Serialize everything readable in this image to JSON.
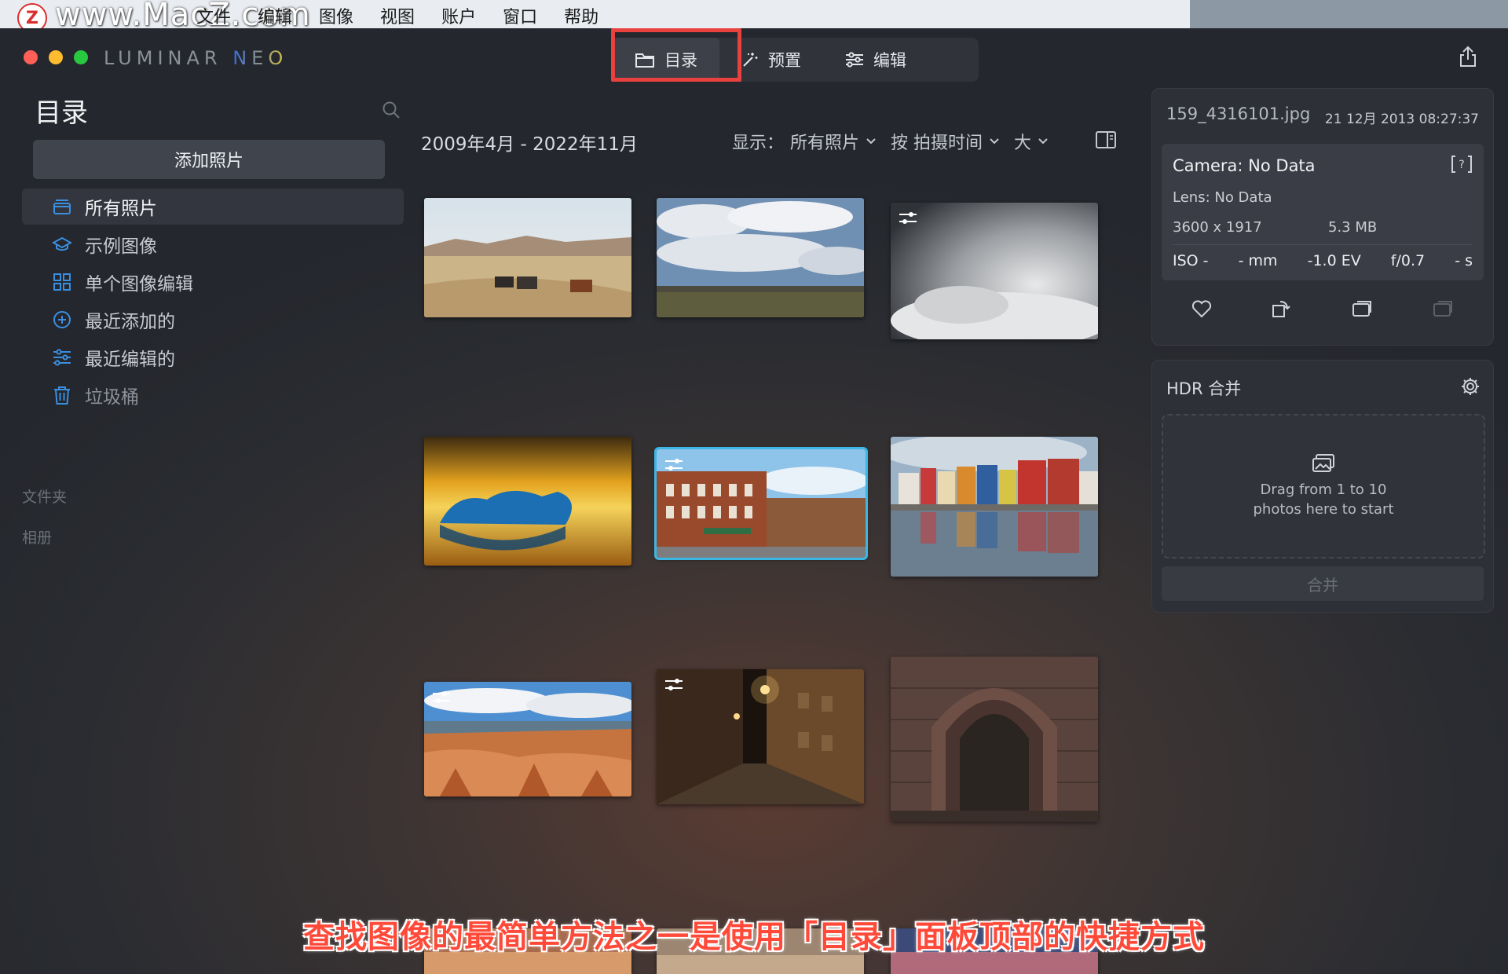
{
  "menubar": {
    "watermark": "www.MacZ.com",
    "app_name": "Luminar Neo",
    "menus": [
      "文件",
      "编辑",
      "图像",
      "视图",
      "账户",
      "窗口",
      "帮助"
    ]
  },
  "window": {
    "logo_left": "LUMINAR ",
    "logo_right": "NEO"
  },
  "tabs": [
    {
      "label": "目录",
      "icon": "folder-icon",
      "active": true
    },
    {
      "label": "预置",
      "icon": "sparkle-icon",
      "active": false
    },
    {
      "label": "编辑",
      "icon": "sliders-icon",
      "active": false
    }
  ],
  "sidebar": {
    "title": "目录",
    "add_button": "添加照片",
    "items": [
      {
        "label": "所有照片",
        "icon": "stack-icon"
      },
      {
        "label": "示例图像",
        "icon": "graduation-cap-icon"
      },
      {
        "label": "单个图像编辑",
        "icon": "grid-icon"
      },
      {
        "label": "最近添加的",
        "icon": "plus-circle-icon"
      },
      {
        "label": "最近编辑的",
        "icon": "sliders-icon"
      },
      {
        "label": "垃圾桶",
        "icon": "trash-icon"
      }
    ],
    "section_folders": "文件夹",
    "section_albums": "相册"
  },
  "main": {
    "date_range": "2009年4月 - 2022年11月",
    "show_label": "显示：",
    "show_value": "所有照片",
    "sort_value": "按 拍摄时间",
    "size_value": "大"
  },
  "info": {
    "filename": "159_4316101.jpg",
    "date": "21 12月 2013 08:27:37",
    "camera": "Camera: No Data",
    "lens": "Lens: No Data",
    "dimensions": "3600 x 1917",
    "filesize": "5.3 MB",
    "iso": "ISO -",
    "focal": "- mm",
    "ev": "-1.0 EV",
    "aperture": "f/0.7",
    "shutter": "- s"
  },
  "hdr": {
    "title": "HDR 合并",
    "drop_text": "Drag from 1 to 10 photos here to start",
    "merge_button": "合并"
  },
  "caption": "查找图像的最简单方法之一是使用「目录」面板顶部的快捷方式",
  "colors": {
    "accent_blue": "#3cb6e3",
    "highlight_red": "#e8413e",
    "sidebar_icon_blue": "#3b8fe0"
  }
}
